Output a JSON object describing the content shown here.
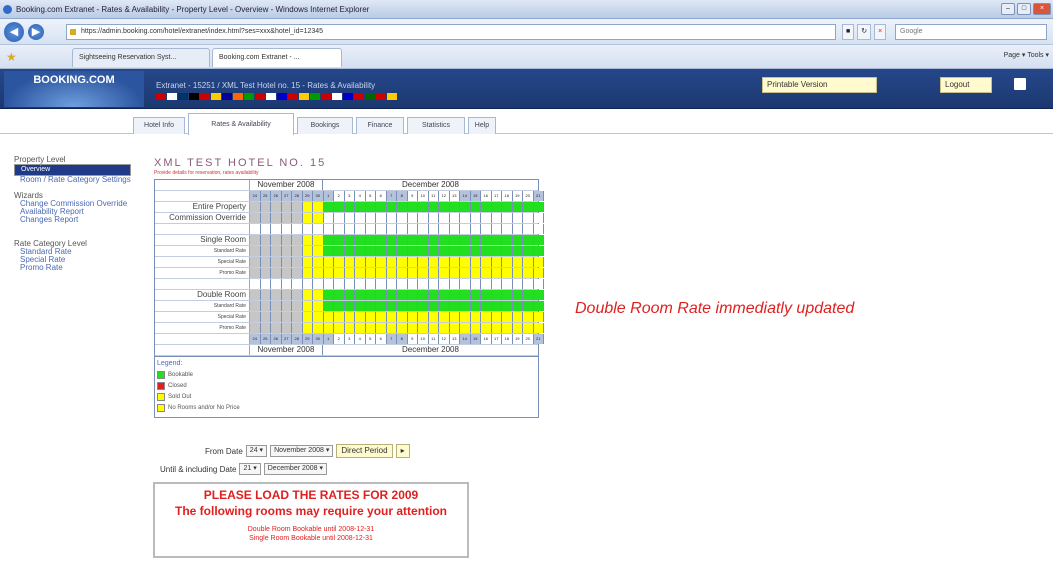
{
  "window": {
    "title": "Booking.com Extranet - Rates & Availability - Property Level - Overview - Windows Internet Explorer"
  },
  "browser": {
    "url": "https://admin.booking.com/hotel/extranet/index.html?ses=xxx&hotel_id=12345",
    "search_placeholder": "Google",
    "tabs": [
      "Sightseeing Reservation Syst...",
      "Booking.com Extranet - ..."
    ],
    "tools": "Page ▾  Tools ▾"
  },
  "header": {
    "logo": "BOOKING.COM",
    "title": "Extranet - 15251 / XML Test Hotel no. 15 - Rates & Availability",
    "printable": "Printable Version",
    "logout": "Logout"
  },
  "tabs": [
    "Hotel Info",
    "Rates & Availability",
    "Bookings",
    "Finance",
    "Statistics",
    "Help"
  ],
  "active_tab": 1,
  "nav": {
    "property": "Property Level",
    "overview": "Overview",
    "room_settings": "Room / Rate Category Settings",
    "wizards": "Wizards",
    "wizard_items": [
      "Change Commission Override",
      "Availability Report",
      "Changes Report"
    ],
    "rate_level": "Rate Category Level",
    "rate_items": [
      "Standard Rate",
      "Special Rate",
      "Promo Rate"
    ]
  },
  "hotel": {
    "name": "XML TEST HOTEL NO. 15",
    "sub": "Provide details for reservation, rates availability"
  },
  "calendar": {
    "month1": "November 2008",
    "month2": "December 2008",
    "dates1": [
      "24",
      "25",
      "26",
      "27",
      "28",
      "29",
      "30"
    ],
    "dates2": [
      "1",
      "2",
      "3",
      "4",
      "5",
      "6",
      "7",
      "8",
      "9",
      "10",
      "11",
      "12",
      "13",
      "14",
      "15",
      "16",
      "17",
      "18",
      "19",
      "20",
      "21"
    ],
    "rows": [
      {
        "label": "Entire Property",
        "sub": false,
        "kind": "gn"
      },
      {
        "label": "Commission Override",
        "sub": false,
        "kind": "wh"
      },
      {
        "label": "",
        "sub": false,
        "kind": "sp"
      },
      {
        "label": "Single Room",
        "sub": false,
        "kind": "gn"
      },
      {
        "label": "Standard Rate",
        "sub": true,
        "kind": "gn"
      },
      {
        "label": "Special Rate",
        "sub": true,
        "kind": "ye"
      },
      {
        "label": "Promo Rate",
        "sub": true,
        "kind": "ye"
      },
      {
        "label": "",
        "sub": false,
        "kind": "sp"
      },
      {
        "label": "Double Room",
        "sub": false,
        "kind": "gn"
      },
      {
        "label": "Standard Rate",
        "sub": true,
        "kind": "gn"
      },
      {
        "label": "Special Rate",
        "sub": true,
        "kind": "ye"
      },
      {
        "label": "Promo Rate",
        "sub": true,
        "kind": "ye"
      }
    ]
  },
  "legend": {
    "title": "Legend:",
    "items": [
      {
        "label": "Bookable",
        "color": "#22e01f"
      },
      {
        "label": "Closed",
        "color": "#e02020"
      },
      {
        "label": "Sold Out",
        "color": "#ffff00"
      },
      {
        "label": "No Rooms and/or No Price",
        "color": "#ffff00"
      }
    ]
  },
  "form": {
    "from_label": "From Date",
    "from_day": "24",
    "from_month": "November 2008",
    "direct_period": "Direct Period",
    "until_label": "Until & including Date",
    "until_day": "21",
    "until_month": "December 2008"
  },
  "notice": {
    "line1": "PLEASE LOAD THE RATES FOR 2009",
    "line2": "The following rooms may require your attention",
    "r1": "Double Room Bookable until 2008-12-31",
    "r2": "Single Room Bookable until 2008-12-31"
  },
  "message": "Double Room Rate immediatly updated"
}
